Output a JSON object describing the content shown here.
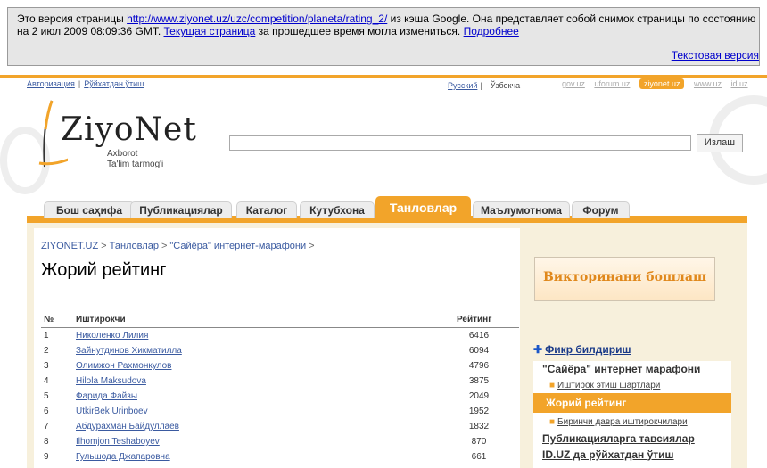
{
  "cache_banner": {
    "text_before": "Это версия страницы ",
    "url": "http://www.ziyonet.uz/uzc/competition/planeta/rating_2/",
    "text_mid": " из кэша Google. Она представляет собой снимок страницы по состоянию на 2 июл 2009 08:09:36 GMT. ",
    "current_page_link": "Текущая страница",
    "text_after": " за прошедшее время могла измениться. ",
    "more_link": "Подробнее",
    "text_version": "Текстовая версия"
  },
  "topbar": {
    "login": "Авторизация",
    "register": "Рўйхатдан ўтиш",
    "lang_ru": "Русский",
    "lang_uz": "Ўзбекча",
    "sites": [
      "gov.uz",
      "uforum.uz",
      "ziyonet.uz",
      "www.uz",
      "id.uz"
    ],
    "active_site": "ziyonet.uz"
  },
  "logo": {
    "brand": "ZiyoNet",
    "tagline1": "Axborot",
    "tagline2": "Ta'lim tarmog'i"
  },
  "search": {
    "value": "",
    "button": "Излаш"
  },
  "tabs": [
    {
      "label": "Бош саҳифа"
    },
    {
      "label": "Публикациялар"
    },
    {
      "label": "Каталог"
    },
    {
      "label": "Кутубхона"
    },
    {
      "label": "Танловлар"
    },
    {
      "label": "Маълумотнома"
    },
    {
      "label": "Форум"
    }
  ],
  "breadcrumb": [
    "ZIYONET.UZ",
    "Танловлар",
    "\"Сайёра\" интернет-марафони"
  ],
  "breadcrumb_sep": ">",
  "page_title": "Жорий рейтинг",
  "table": {
    "headers": {
      "num": "№",
      "name": "Иштирокчи",
      "score": "Рейтинг"
    },
    "rows": [
      {
        "num": "1",
        "name": "Николенко Лилия",
        "score": "6416"
      },
      {
        "num": "2",
        "name": "Зайнутдинов Хикматилла",
        "score": "6094"
      },
      {
        "num": "3",
        "name": "Олимжон Рахмонкулов",
        "score": "4796"
      },
      {
        "num": "4",
        "name": "Hilola Maksudova",
        "score": "3875"
      },
      {
        "num": "5",
        "name": "Фарида Файзы",
        "score": "2049"
      },
      {
        "num": "6",
        "name": "UtkirBek Urinboev",
        "score": "1952"
      },
      {
        "num": "7",
        "name": "Абдурахман Байдуллаев",
        "score": "1832"
      },
      {
        "num": "8",
        "name": "Ilhomjon Teshaboyev",
        "score": "870"
      },
      {
        "num": "9",
        "name": "Гульшода Джапаровна",
        "score": "661"
      }
    ]
  },
  "sidebar": {
    "banner": "Викторинани бошлаш",
    "feedback": "Фикр билдириш",
    "menu": {
      "section": "\"Сайёра\" интернет марафони",
      "sub1": "Иштирок этиш шартлари",
      "active": "Жорий рейтинг",
      "sub2": "Биринчи давра иштирокчилари",
      "item2": "Публикацияларга тавсиялар",
      "item3": "ID.UZ да рўйхатдан ўтиш"
    }
  },
  "colors": {
    "accent": "#f2a42a",
    "link": "#0000cc",
    "content_bg": "#f7f0dc"
  }
}
